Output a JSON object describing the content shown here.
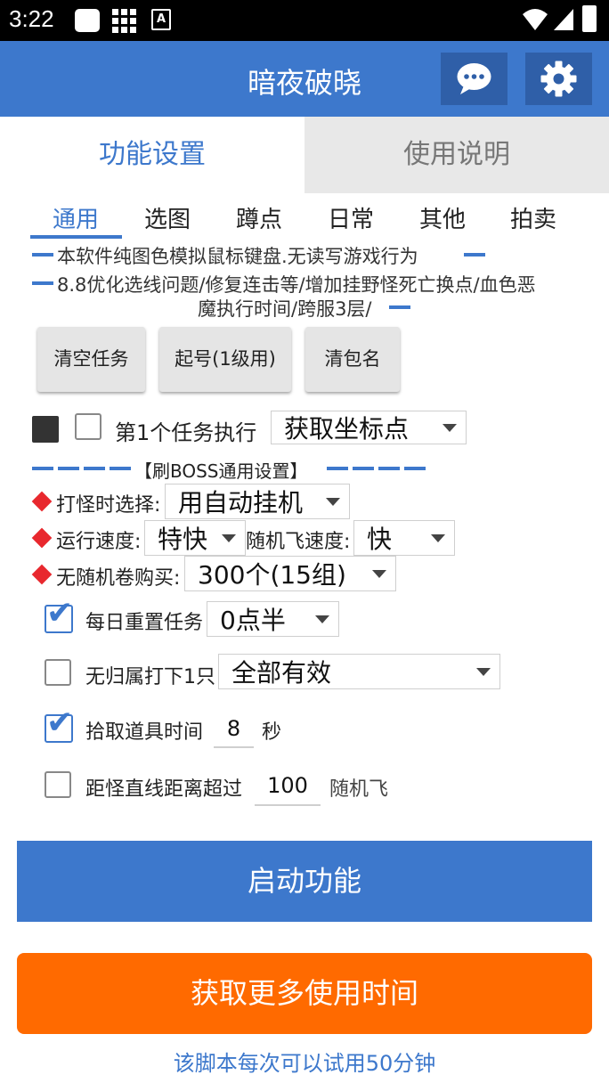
{
  "status_bar": {
    "time": "3:22",
    "sim_icon_letter": "A"
  },
  "header": {
    "title": "暗夜破晓",
    "chat_icon": "chat-bubble-icon",
    "settings_icon": "gear-icon"
  },
  "tabs": [
    {
      "label": "功能设置",
      "active": true
    },
    {
      "label": "使用说明",
      "active": false
    }
  ],
  "subtabs": [
    "通用",
    "选图",
    "蹲点",
    "日常",
    "其他",
    "拍卖"
  ],
  "notices": {
    "line1": "本软件纯图色模拟鼠标键盘.无读写游戏行为",
    "line2": "8.8优化选线问题/修复连击等/增加挂野怪死亡换点/血色恶",
    "line3": "魔执行时间/跨服3层/"
  },
  "buttons": {
    "clear_tasks": "清空任务",
    "start_account": "起号(1级用)",
    "clear_package": "清包名"
  },
  "task_row": {
    "label": "第1个任务执行",
    "select_value": "获取坐标点"
  },
  "boss_section": {
    "title": "【刷BOSS通用设置】",
    "fight_select_label": "打怪时选择:",
    "fight_select_value": "用自动挂机",
    "run_speed_label": "运行速度:",
    "run_speed_value": "特快",
    "random_fly_speed_label": "随机飞速度:",
    "random_fly_speed_value": "快",
    "no_scroll_buy_label": "无随机卷购买:",
    "no_scroll_buy_value": "300个(15组)"
  },
  "options": {
    "daily_reset": {
      "label": "每日重置任务",
      "checked": true,
      "value": "0点半"
    },
    "no_owner": {
      "label": "无归属打下1只",
      "checked": false,
      "value": "全部有效"
    },
    "pickup": {
      "label": "拾取道具时间",
      "checked": true,
      "value": "8",
      "unit": "秒"
    },
    "distance": {
      "label": "距怪直线距离超过",
      "checked": false,
      "value": "100",
      "suffix": "随机飞"
    }
  },
  "actions": {
    "start": "启动功能",
    "more_time": "获取更多使用时间",
    "trial_note": "该脚本每次可以试用50分钟"
  },
  "colors": {
    "primary": "#3d78cc",
    "header": "#3d78cc",
    "orange": "#ff6a00",
    "red": "#e8282e"
  }
}
